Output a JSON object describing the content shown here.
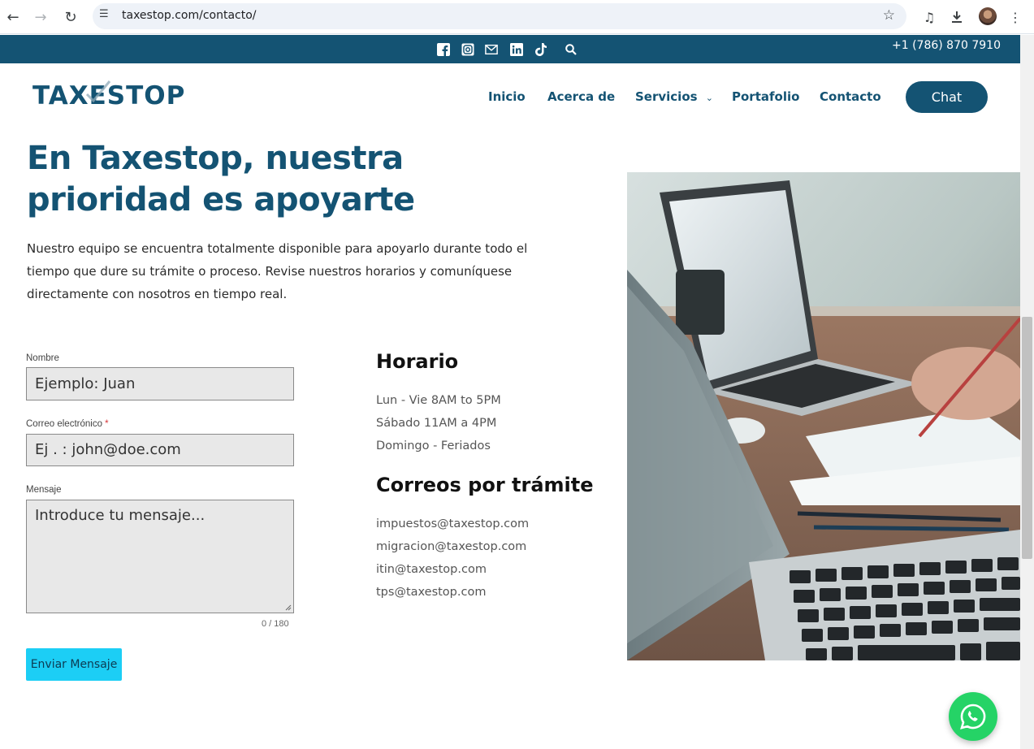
{
  "browser": {
    "url": "taxestop.com/contacto/"
  },
  "topbar": {
    "phone": "+1 (786) 870 7910",
    "social_icons": [
      "facebook-icon",
      "instagram-icon",
      "mail-icon",
      "linkedin-icon",
      "tiktok-icon",
      "search-icon"
    ]
  },
  "header": {
    "logo": "TAXESTOP",
    "nav": [
      "Inicio",
      "Acerca de",
      "Servicios",
      "Portafolio",
      "Contacto"
    ],
    "chat_label": "Chat"
  },
  "hero": {
    "title": "En Taxestop, nuestra prioridad es apoyarte",
    "description": "Nuestro equipo se encuentra totalmente disponible para apoyarlo durante todo el tiempo que dure su trámite o proceso.  Revise nuestros horarios y comuníquese directamente con nosotros en tiempo real."
  },
  "form": {
    "name_label": "Nombre",
    "name_placeholder": "Ejemplo: Juan",
    "email_label": "Correo electrónico",
    "email_required": "*",
    "email_placeholder": "Ej . : john@doe.com",
    "message_label": "Mensaje",
    "message_placeholder": "Introduce tu mensaje...",
    "counter": "0 / 180",
    "submit_label": "Enviar Mensaje"
  },
  "schedule": {
    "title": "Horario",
    "lines": [
      "Lun - Vie 8AM to 5PM",
      "Sábado 11AM a 4PM",
      "Domingo - Feriados"
    ]
  },
  "emails": {
    "title": "Correos por trámite",
    "lines": [
      "impuestos@taxestop.com",
      "migracion@taxestop.com",
      "itin@taxestop.com",
      "tps@taxestop.com"
    ]
  },
  "colors": {
    "brand": "#145373",
    "button": "#1ccef5",
    "whatsapp": "#25d366"
  }
}
